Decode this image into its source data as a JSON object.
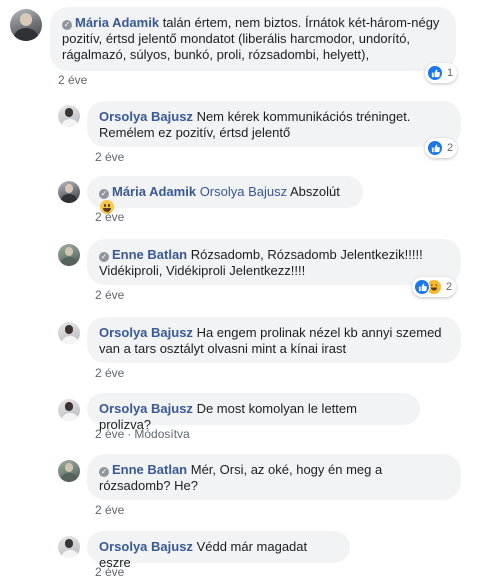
{
  "comments": [
    {
      "author": "Mária Adamik",
      "text": "talán értem, nem biztos. Írnátok két-három-négy pozitív, értsd jelentő mondatot (liberális harcmodor, undorító, rágalmazó, súlyos, bunkó, proli, rózsadombi, helyett),",
      "time": "2 éve",
      "reactions": {
        "count": "1",
        "types": [
          "like"
        ]
      }
    },
    {
      "author": "Orsolya Bajusz",
      "text": "Nem kérek kommunikációs tréninget. Remélem ez pozitív, értsd jelentő",
      "time": "2 éve",
      "reactions": {
        "count": "2",
        "types": [
          "like"
        ]
      }
    },
    {
      "author": "Mária Adamik",
      "mention": "Orsolya Bajusz",
      "text": "Abszolút",
      "emoji": "grinning-face",
      "time": "2 éve"
    },
    {
      "author": "Enne Batlan",
      "text": "Rózsadomb, Rózsadomb Jelentkezik!!!!! Vidékiproli, Vidékiproli Jelentkezz!!!!",
      "time": "2 éve",
      "reactions": {
        "count": "2",
        "types": [
          "like",
          "haha"
        ]
      }
    },
    {
      "author": "Orsolya Bajusz",
      "text": "Ha engem prolinak nézel kb annyi szemed van a tars osztályt olvasni mint a kínai irast",
      "time": "2 éve"
    },
    {
      "author": "Orsolya Bajusz",
      "text": "De most komolyan le lettem prolizva?",
      "time": "2 éve",
      "edited": "Módosítva"
    },
    {
      "author": "Enne Batlan",
      "text": "Mér, Orsi, az oké, hogy én meg a rózsadomb? He?",
      "time": "2 éve"
    },
    {
      "author": "Orsolya Bajusz",
      "text": "Védd már magadat eszre",
      "time": "2 éve"
    }
  ],
  "colors": {
    "author": "#385898",
    "bubble": "#f2f3f5",
    "meta": "#616770",
    "like": "#1877f2",
    "haha": "#f7b928"
  },
  "icons": {
    "fan_badge": "top-fan-check-icon",
    "like": "like-thumb-icon",
    "haha": "haha-face-icon"
  }
}
